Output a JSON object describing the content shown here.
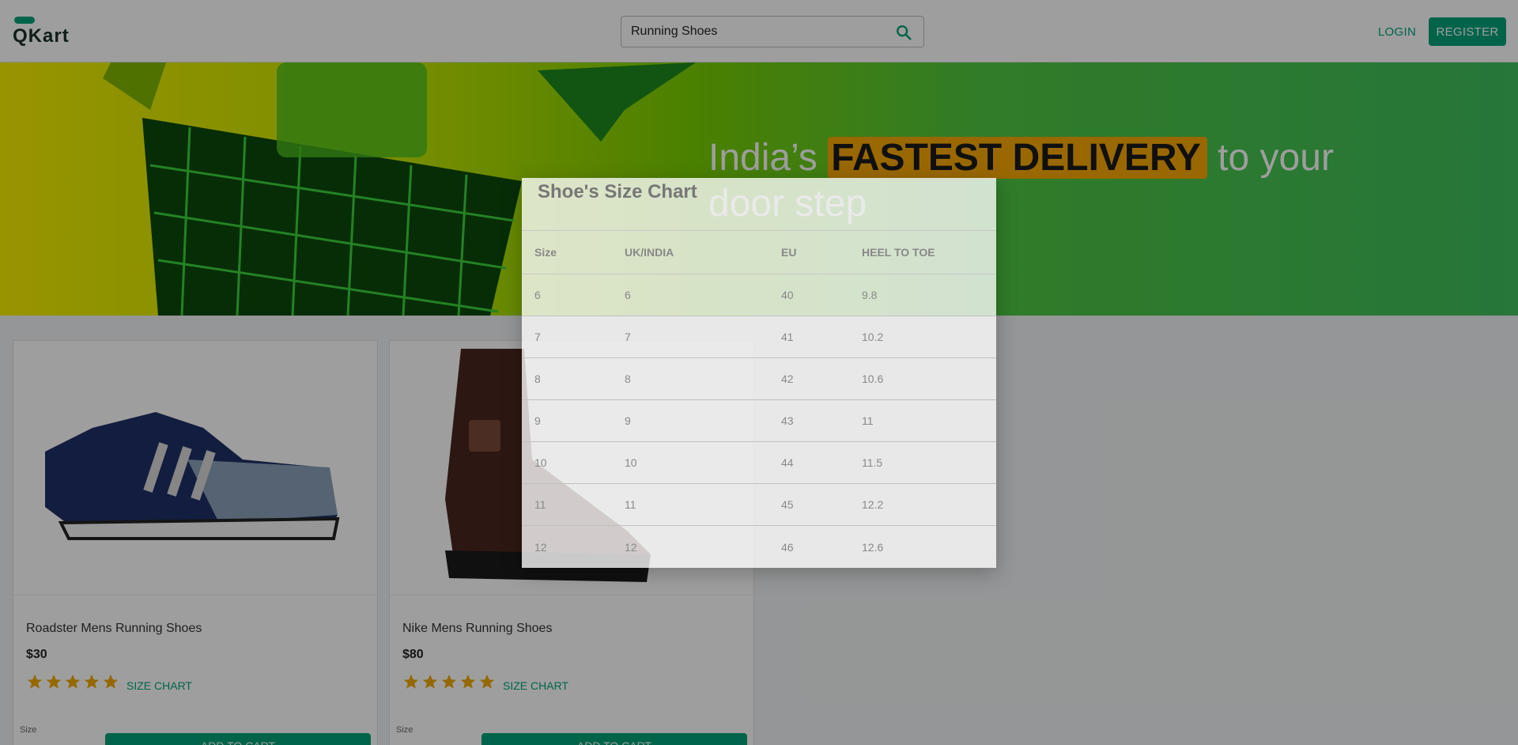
{
  "app": {
    "logo_text": "QKart"
  },
  "header": {
    "search_value": "Running Shoes",
    "login_label": "LOGIN",
    "register_label": "REGISTER"
  },
  "hero": {
    "text_before": "India’s ",
    "highlight": "FASTEST DELIVERY",
    "text_after": " to your door step"
  },
  "products": [
    {
      "title": "Roadster Mens Running Shoes",
      "price": "$30",
      "rating": 5,
      "size_chart_label": "SIZE CHART",
      "size_label": "Size",
      "add_to_cart": "ADD TO CART"
    },
    {
      "title": "Nike Mens Running Shoes",
      "price": "$80",
      "rating": 5,
      "size_chart_label": "SIZE CHART",
      "size_label": "Size",
      "add_to_cart": "ADD TO CART"
    }
  ],
  "size_chart": {
    "title": "Shoe's Size Chart",
    "columns": [
      "Size",
      "UK/INDIA",
      "EU",
      "HEEL TO TOE"
    ],
    "rows": [
      [
        "6",
        "6",
        "40",
        "9.8"
      ],
      [
        "7",
        "7",
        "41",
        "10.2"
      ],
      [
        "8",
        "8",
        "42",
        "10.6"
      ],
      [
        "9",
        "9",
        "43",
        "11"
      ],
      [
        "10",
        "10",
        "44",
        "11.5"
      ],
      [
        "11",
        "11",
        "45",
        "12.2"
      ],
      [
        "12",
        "12",
        "46",
        "12.6"
      ]
    ]
  },
  "colors": {
    "accent": "#00a278",
    "star": "#f2a900",
    "highlight": "#f7a800"
  }
}
